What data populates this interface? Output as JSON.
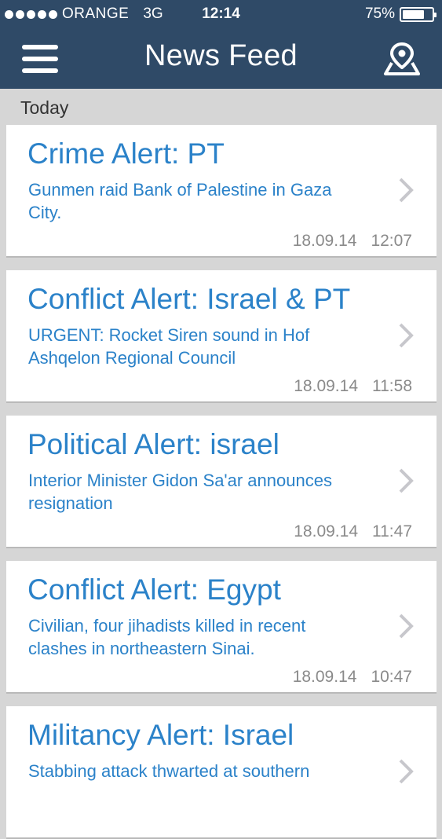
{
  "status_bar": {
    "carrier": "ORANGE",
    "network": "3G",
    "time": "12:14",
    "battery_text": "75%",
    "battery_level": 0.75,
    "signal_bars_filled": 5
  },
  "nav": {
    "title": "News Feed",
    "menu_icon": "hamburger-menu-icon",
    "map_icon": "map-pin-icon"
  },
  "section": {
    "label": "Today"
  },
  "feed": {
    "items": [
      {
        "title": "Crime Alert: PT",
        "description": "Gunmen raid Bank of Palestine in Gaza City.",
        "date": "18.09.14",
        "time": "12:07"
      },
      {
        "title": "Conflict Alert: Israel & PT",
        "description": "URGENT: Rocket Siren sound in Hof Ashqelon Regional Council",
        "date": "18.09.14",
        "time": "11:58"
      },
      {
        "title": "Political Alert: israel",
        "description": "Interior Minister Gidon Sa'ar announces resignation",
        "date": "18.09.14",
        "time": "11:47"
      },
      {
        "title": "Conflict Alert: Egypt",
        "description": "Civilian, four jihadists killed in recent clashes in northeastern Sinai.",
        "date": "18.09.14",
        "time": "10:47"
      },
      {
        "title": "Militancy Alert: Israel",
        "description": "Stabbing attack thwarted at southern",
        "date": "",
        "time": ""
      }
    ]
  },
  "colors": {
    "navbar": "#2f4a67",
    "accent": "#2b82c9",
    "background": "#d6d6d6",
    "meta_text": "#8a8a8a"
  }
}
